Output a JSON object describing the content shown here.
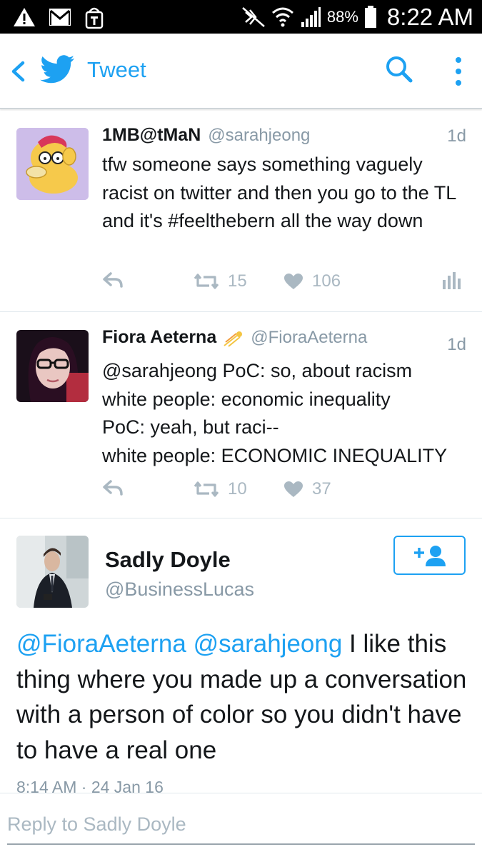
{
  "status_bar": {
    "battery_percent": "88%",
    "time": "8:22 AM",
    "icons": [
      "warning-icon",
      "gmail-icon",
      "tmobile-icon",
      "nfc-mute-icon",
      "wifi-icon",
      "signal-icon",
      "battery-icon"
    ]
  },
  "app_bar": {
    "title": "Tweet",
    "icons": [
      "back-icon",
      "twitter-bird-icon",
      "search-icon",
      "overflow-menu-icon"
    ]
  },
  "tweets": [
    {
      "name": "1MB@tMaN",
      "handle": "@sarahjeong",
      "time": "1d",
      "text": "tfw someone says something vaguely racist on twitter and then you go to the TL and it's #feelthebern all the way down",
      "retweets": "15",
      "likes": "106",
      "avatar_icon": "psyduck-avatar"
    },
    {
      "name": "Fiora Aeterna",
      "handle": "@FioraAeterna",
      "time": "1d",
      "lines": [
        "@sarahjeong PoC: so, about racism",
        "white people: economic inequality",
        "PoC: yeah, but raci--",
        "white people: ECONOMIC INEQUALITY"
      ],
      "retweets": "10",
      "likes": "37",
      "name_icon": "comet-emoji-icon"
    }
  ],
  "focused_tweet": {
    "name": "Sadly Doyle",
    "handle": "@BusinessLucas",
    "mention_1": "@FioraAeterna",
    "mention_2": "@sarahjeong",
    "text": " I like this thing where you made up a conversation with a person of color so you didn't have to have a real one",
    "timestamp": "8:14 AM · 24 Jan 16"
  },
  "reply": {
    "placeholder": "Reply to Sadly Doyle"
  },
  "colors": {
    "accent": "#1da1f2",
    "muted": "#8899a6",
    "action_gray": "#aab8c2",
    "text": "#14171a"
  }
}
